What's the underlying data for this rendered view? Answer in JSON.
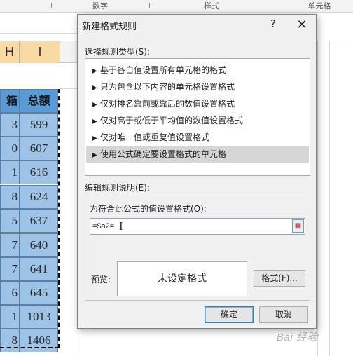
{
  "ribbon": {
    "groups": [
      "数字",
      "样式",
      "单元格"
    ]
  },
  "sheet": {
    "column_headers": [
      "H",
      "I"
    ],
    "table_headers": [
      "箱",
      "总额"
    ],
    "rows": [
      {
        "h": "3",
        "i": "599"
      },
      {
        "h": "0",
        "i": "607"
      },
      {
        "h": "1",
        "i": "616"
      },
      {
        "h": "8",
        "i": "624"
      },
      {
        "h": "5",
        "i": "637"
      },
      {
        "h": "7",
        "i": "640"
      },
      {
        "h": "7",
        "i": "641"
      },
      {
        "h": "6",
        "i": "645"
      },
      {
        "h": "1",
        "i": "1013"
      },
      {
        "h": "8",
        "i": "1406"
      }
    ],
    "colors": {
      "header_fill": "#5b9bd5",
      "cell_fill": "#9dc3e6",
      "selected_column_header": "#f9d9a4"
    }
  },
  "dialog": {
    "title": "新建格式规则",
    "help": "?",
    "close": "✕",
    "select_type_label": "选择规则类型(S):",
    "rule_types": [
      "基于各自值设置所有单元格的格式",
      "只为包含以下内容的单元格设置格式",
      "仅对排名靠前或靠后的数值设置格式",
      "仅对高于或低于平均值的数值设置格式",
      "仅对唯一值或重复值设置格式",
      "使用公式确定要设置格式的单元格"
    ],
    "selected_rule_index": 5,
    "edit_label": "编辑规则说明(E):",
    "formula_label": "为符合此公式的值设置格式(O):",
    "formula_value": "=$a2=",
    "preview_label": "预览:",
    "preview_text": "未设定格式",
    "format_button": "格式(F)...",
    "ok_button": "确定",
    "cancel_button": "取消"
  },
  "watermark": "Bai 经验"
}
